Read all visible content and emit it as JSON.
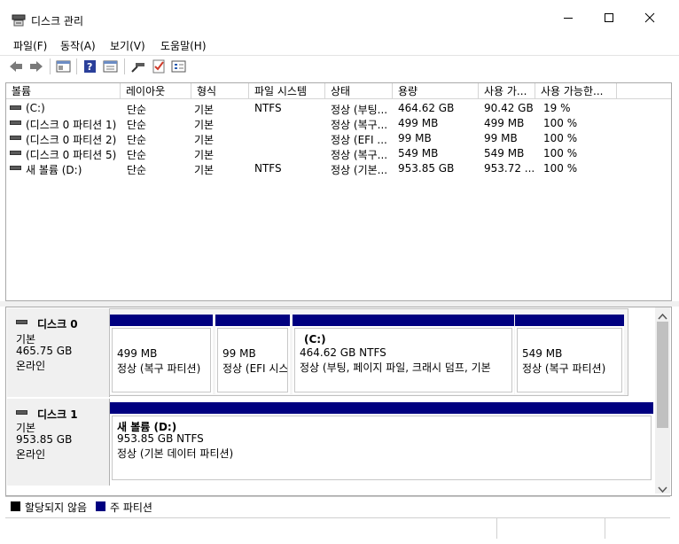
{
  "window": {
    "title": "디스크 관리",
    "icon": "disk-management-icon"
  },
  "menu": [
    {
      "label": "파일(F)"
    },
    {
      "label": "동작(A)"
    },
    {
      "label": "보기(V)"
    },
    {
      "label": "도움말(H)"
    }
  ],
  "toolbar": {
    "icons": [
      "back-arrow-icon",
      "forward-arrow-icon",
      "properties-icon",
      "help-icon",
      "console-tree-icon",
      "connect-icon",
      "checklist-icon",
      "disk-properties-icon"
    ]
  },
  "volume_table": {
    "columns": [
      "볼륨",
      "레이아웃",
      "형식",
      "파일 시스템",
      "상태",
      "용량",
      "사용 가...",
      "사용 가능한..."
    ],
    "rows": [
      {
        "volume": "(C:)",
        "layout": "단순",
        "type": "기본",
        "fs": "NTFS",
        "status": "정상 (부팅...",
        "capacity": "464.62 GB",
        "free": "90.42 GB",
        "pct": "19 %"
      },
      {
        "volume": "(디스크 0 파티션 1)",
        "layout": "단순",
        "type": "기본",
        "fs": "",
        "status": "정상 (복구...",
        "capacity": "499 MB",
        "free": "499 MB",
        "pct": "100 %"
      },
      {
        "volume": "(디스크 0 파티션 2)",
        "layout": "단순",
        "type": "기본",
        "fs": "",
        "status": "정상 (EFI ...",
        "capacity": "99 MB",
        "free": "99 MB",
        "pct": "100 %"
      },
      {
        "volume": "(디스크 0 파티션 5)",
        "layout": "단순",
        "type": "기본",
        "fs": "",
        "status": "정상 (복구...",
        "capacity": "549 MB",
        "free": "549 MB",
        "pct": "100 %"
      },
      {
        "volume": "새 볼륨 (D:)",
        "layout": "단순",
        "type": "기본",
        "fs": "NTFS",
        "status": "정상 (기본...",
        "capacity": "953.85 GB",
        "free": "953.72 ...",
        "pct": "100 %"
      }
    ]
  },
  "disks": [
    {
      "name": "디스크 0",
      "kind": "기본",
      "size": "465.75 GB",
      "state": "온라인",
      "partitions": [
        {
          "title": "",
          "size": "499 MB",
          "status": "정상 (복구 파티션)"
        },
        {
          "title": "",
          "size": "99 MB",
          "status": "정상 (EFI 시스"
        },
        {
          "title": "(C:)",
          "size": "464.62 GB NTFS",
          "status": "정상 (부팅, 페이지 파일, 크래시 덤프, 기본 "
        },
        {
          "title": "",
          "size": "549 MB",
          "status": "정상 (복구 파티션)"
        }
      ]
    },
    {
      "name": "디스크 1",
      "kind": "기본",
      "size": "953.85 GB",
      "state": "온라인",
      "partitions": [
        {
          "title": "새 볼륨  (D:)",
          "size": "953.85 GB NTFS",
          "status": "정상 (기본 데이터 파티션)"
        }
      ]
    }
  ],
  "legend": [
    {
      "label": "할당되지 않음",
      "color": "#000000"
    },
    {
      "label": "주 파티션",
      "color": "#000080"
    }
  ],
  "colors": {
    "primary_partition": "#000080",
    "unallocated": "#000000"
  }
}
